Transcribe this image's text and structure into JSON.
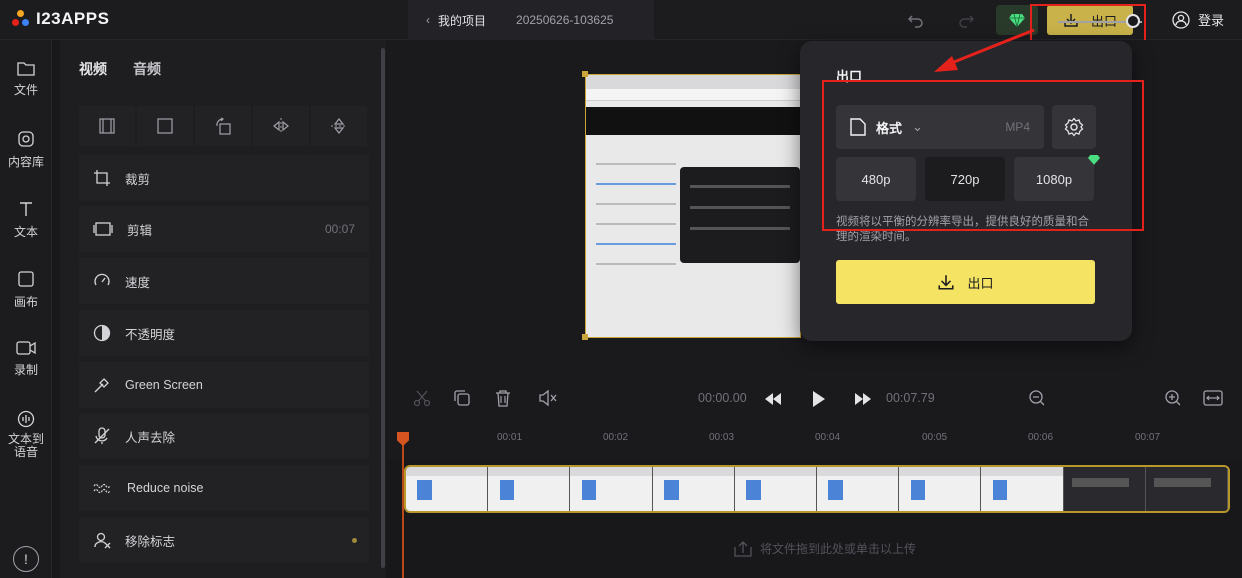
{
  "app": {
    "logo_text": "I23APPS",
    "accent": "#f5e463",
    "highlight_color": "#e4221b"
  },
  "header": {
    "back_label": "我的项目",
    "project_name": "20250626-103625",
    "export_label": "出口",
    "login_label": "登录"
  },
  "rail": [
    {
      "label": "文件",
      "icon": "folder-icon"
    },
    {
      "label": "内容库",
      "icon": "library-icon"
    },
    {
      "label": "文本",
      "icon": "text-icon"
    },
    {
      "label": "画布",
      "icon": "canvas-icon"
    },
    {
      "label": "录制",
      "icon": "record-icon"
    },
    {
      "label": "文本到语音",
      "icon": "tts-icon"
    }
  ],
  "panel": {
    "tabs": [
      "视频",
      "音频"
    ],
    "tools": [
      {
        "label": "裁剪",
        "value": ""
      },
      {
        "label": "剪辑",
        "value": "00:07"
      },
      {
        "label": "速度",
        "value": ""
      },
      {
        "label": "不透明度",
        "value": ""
      },
      {
        "label": "Green Screen",
        "value": ""
      },
      {
        "label": "人声去除",
        "value": ""
      },
      {
        "label": "Reduce noise",
        "value": ""
      },
      {
        "label": "移除标志",
        "value": ""
      }
    ]
  },
  "export_popover": {
    "title": "出口",
    "format_label": "格式",
    "format_value": "MP4",
    "resolutions": [
      "480p",
      "720p",
      "1080p"
    ],
    "selected_resolution": "720p",
    "description": "视频将以平衡的分辨率导出，提供良好的质量和合理的渲染时间。",
    "export_button": "出口"
  },
  "transport": {
    "current_time": "00:00.00",
    "total_time": "00:07.79"
  },
  "timeline": {
    "ticks": [
      "00:01",
      "00:02",
      "00:03",
      "00:04",
      "00:05",
      "00:06",
      "00:07"
    ],
    "drop_hint": "将文件拖到此处或单击以上传"
  }
}
